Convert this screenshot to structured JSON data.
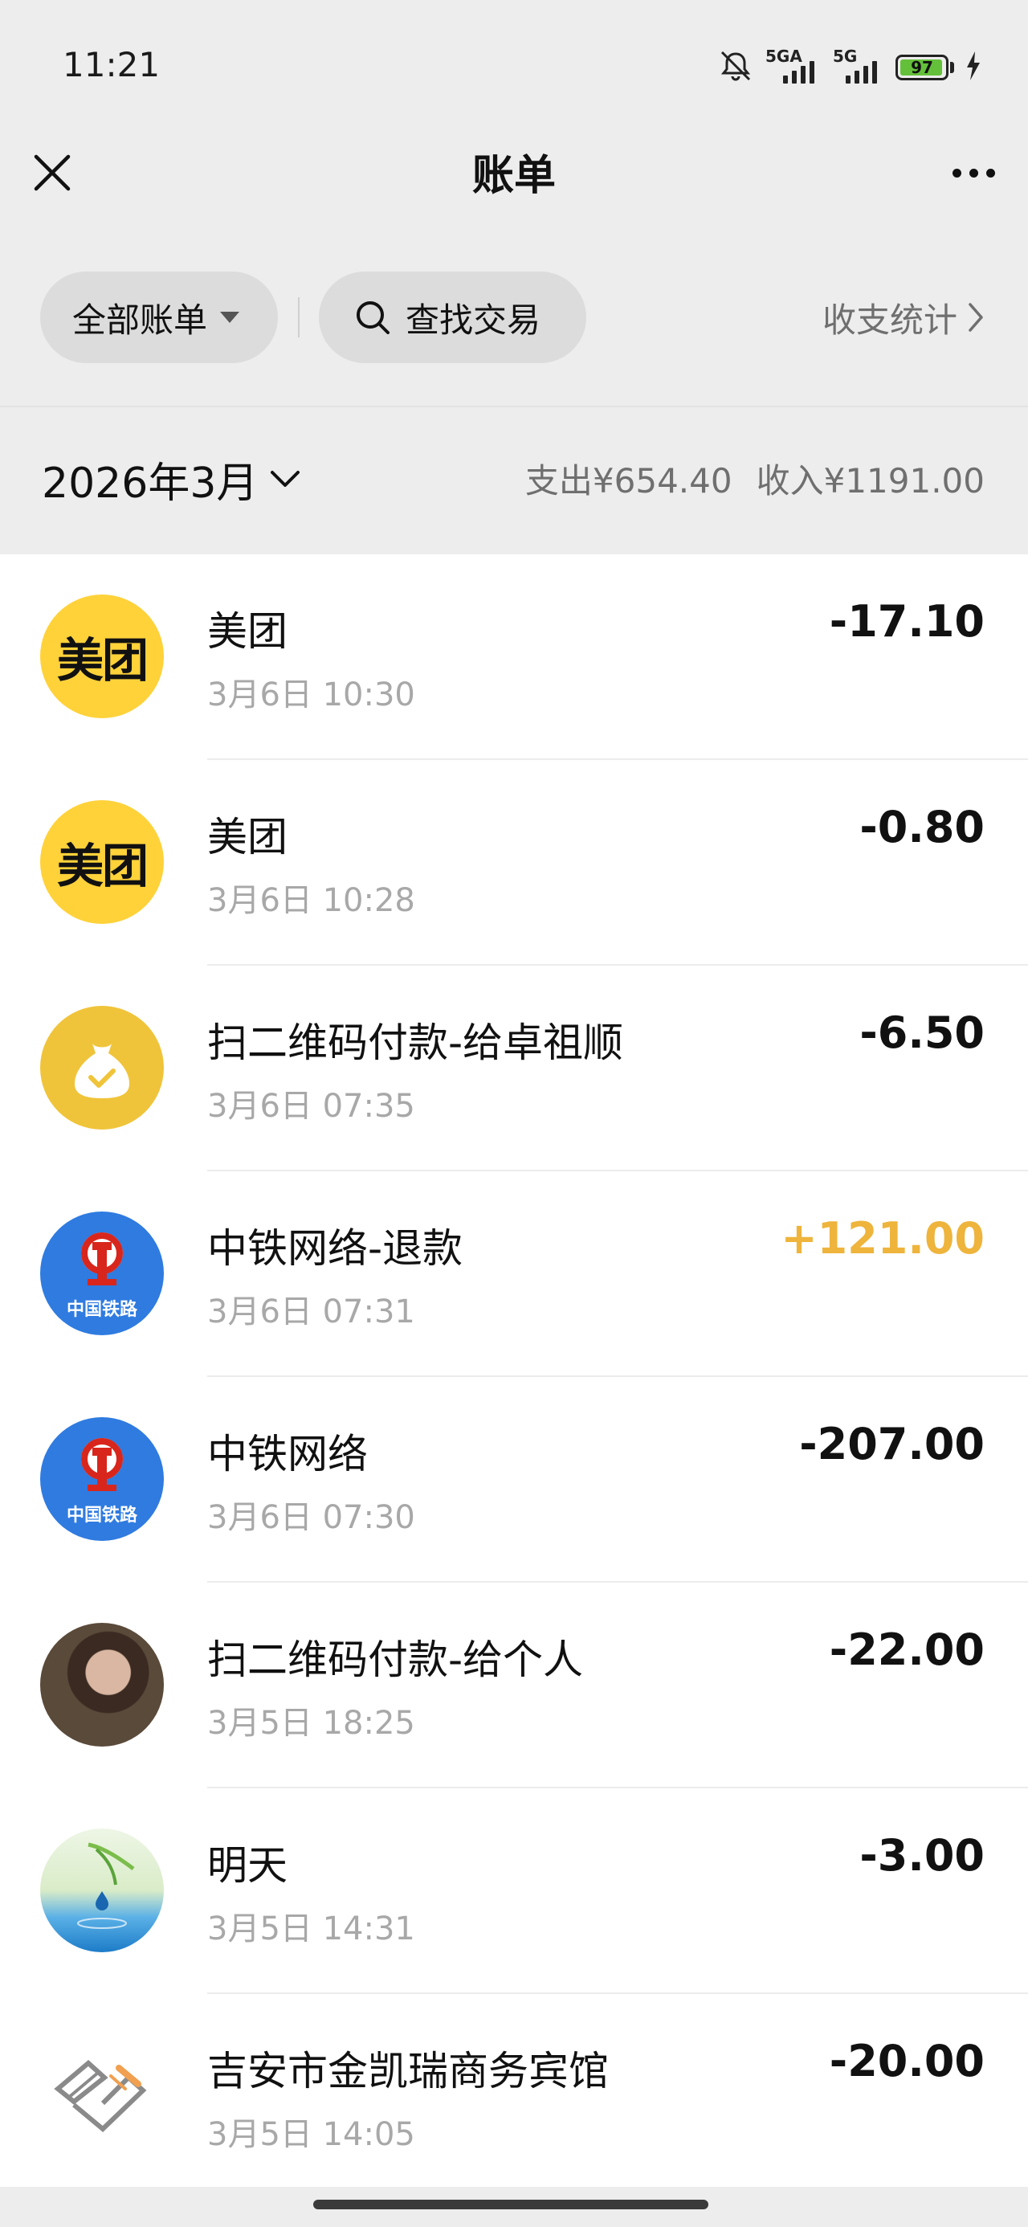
{
  "status_bar": {
    "time": "11:21",
    "signal_1_label": "5GA",
    "signal_2_label": "5G",
    "battery_level": "97",
    "battery_fraction": 0.97
  },
  "header": {
    "title": "账单"
  },
  "filters": {
    "all_bills": "全部账单",
    "search": "查找交易",
    "stats": "收支统计"
  },
  "month_bar": {
    "month": "2026年3月",
    "expense": "支出¥654.40",
    "income": "收入¥1191.00"
  },
  "transactions": [
    {
      "name": "美团",
      "time": "3月6日 10:30",
      "amount": "-17.10",
      "type": "expense",
      "icon": "meituan-logo"
    },
    {
      "name": "美团",
      "time": "3月6日 10:28",
      "amount": "-0.80",
      "type": "expense",
      "icon": "meituan-logo"
    },
    {
      "name": "扫二维码付款-给卓祖顺",
      "time": "3月6日 07:35",
      "amount": "-6.50",
      "type": "expense",
      "icon": "money-bag-icon"
    },
    {
      "name": "中铁网络-退款",
      "time": "3月6日 07:31",
      "amount": "+121.00",
      "type": "income",
      "icon": "china-railway-logo"
    },
    {
      "name": "中铁网络",
      "time": "3月6日 07:30",
      "amount": "-207.00",
      "type": "expense",
      "icon": "china-railway-logo"
    },
    {
      "name": "扫二维码付款-给个人",
      "time": "3月5日 18:25",
      "amount": "-22.00",
      "type": "expense",
      "icon": "person-photo"
    },
    {
      "name": "明天",
      "time": "3月5日 14:31",
      "amount": "-3.00",
      "type": "expense",
      "icon": "water-drop-photo"
    },
    {
      "name": "吉安市金凯瑞商务宾馆",
      "time": "3月5日 14:05",
      "amount": "-20.00",
      "type": "expense",
      "icon": "hotel-logo"
    }
  ],
  "avatar_text": {
    "meituan": "美团",
    "railway": "中国铁路"
  },
  "colors": {
    "background": "#ededed",
    "income_amount": "#eeb43c",
    "meituan_yellow": "#ffd23a",
    "battery_green": "#64c03a"
  }
}
